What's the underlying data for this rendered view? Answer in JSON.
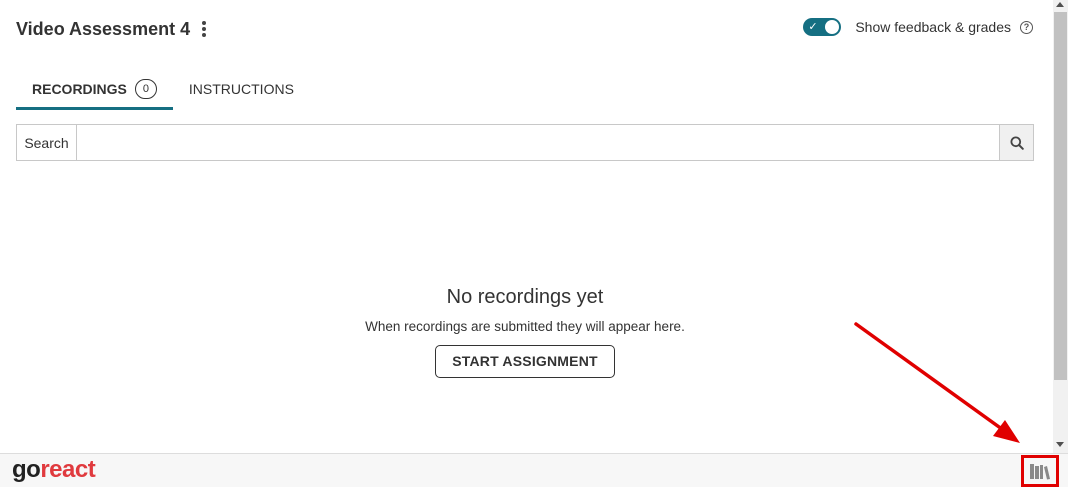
{
  "header": {
    "title": "Video Assessment 4"
  },
  "feedback": {
    "label": "Show feedback & grades",
    "enabled": true,
    "accent": "#156f82"
  },
  "tabs": [
    {
      "label": "RECORDINGS",
      "count": "0",
      "active": true
    },
    {
      "label": "INSTRUCTIONS",
      "active": false
    }
  ],
  "search": {
    "label": "Search",
    "value": "",
    "placeholder": "",
    "icon": "search-icon"
  },
  "empty_state": {
    "title": "No recordings yet",
    "subtitle": "When recordings are submitted they will appear here.",
    "button": "START ASSIGNMENT"
  },
  "footer": {
    "logo_go": "go",
    "logo_react": "react",
    "brand_color": "#e03a3e",
    "library_icon": "library-books-icon"
  },
  "annotation": {
    "color": "#e00000",
    "type": "arrow pointing to library button"
  }
}
